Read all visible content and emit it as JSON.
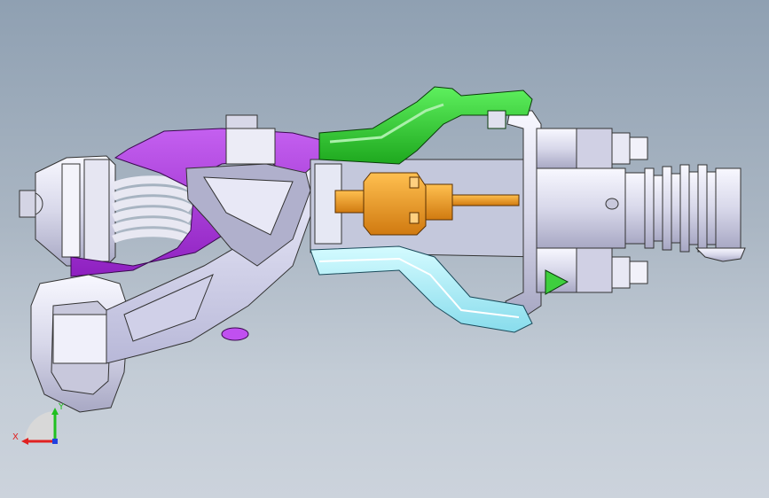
{
  "view": {
    "background_top": "#8fa0b2",
    "background_bottom": "#ccd3dc"
  },
  "model": {
    "parts": [
      {
        "name": "clevis-bracket",
        "color": "#f2f2f8"
      },
      {
        "name": "return-spring",
        "color": "#e6e6ee"
      },
      {
        "name": "purple-housing",
        "color": "#b040e0"
      },
      {
        "name": "pedal-arm",
        "color": "#d8d8f0"
      },
      {
        "name": "pedal-hook",
        "color": "#e4e4f4"
      },
      {
        "name": "green-bracket",
        "color": "#2ecc2e"
      },
      {
        "name": "cyan-bracket",
        "color": "#a8f0f8"
      },
      {
        "name": "orange-rod",
        "color": "#f0a020"
      },
      {
        "name": "orange-nut",
        "color": "#f5a623"
      },
      {
        "name": "master-cylinder",
        "color": "#dedef0"
      },
      {
        "name": "booster-bellows",
        "color": "#e6e6f4"
      },
      {
        "name": "green-cap",
        "color": "#3ecf3e"
      }
    ]
  },
  "triad": {
    "x_label": "X",
    "y_label": "Y",
    "x_color": "#e02020",
    "y_color": "#20c020"
  }
}
